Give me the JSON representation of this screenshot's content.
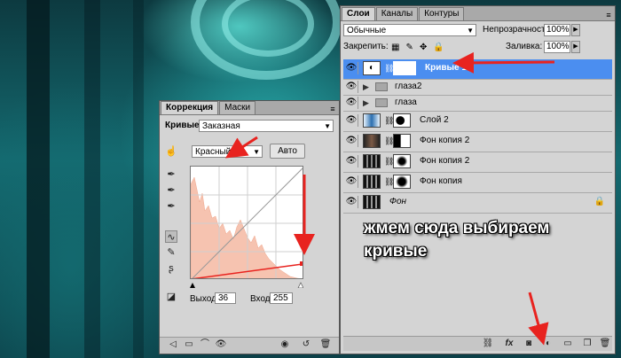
{
  "layers_panel": {
    "tabs": [
      "Слои",
      "Каналы",
      "Контуры"
    ],
    "blend_mode": "Обычные",
    "opacity_label": "Непрозрачность:",
    "opacity_value": "100%",
    "lock_label": "Закрепить:",
    "fill_label": "Заливка:",
    "fill_value": "100%",
    "layers": [
      {
        "name": "Кривые 1",
        "selected": true
      },
      {
        "name": "глаза2",
        "type": "group"
      },
      {
        "name": "глаза",
        "type": "group"
      },
      {
        "name": "Слой 2"
      },
      {
        "name": "Фон копия 2"
      },
      {
        "name": "Фон копия 2"
      },
      {
        "name": "Фон копия"
      },
      {
        "name": "Фон",
        "locked": true
      }
    ],
    "footer_icons": [
      "link-icon",
      "fx-icon",
      "mask-icon",
      "adjustment-layer-icon",
      "group-icon",
      "new-layer-icon",
      "trash-icon"
    ]
  },
  "annotation": {
    "line1": "жмем сюда выбираем",
    "line2": "кривые"
  },
  "correction_panel": {
    "tabs": [
      "Коррекция",
      "Маски"
    ],
    "title": "Кривые",
    "preset": "Заказная",
    "channel": "Красный",
    "auto_button": "Авто",
    "output_label": "Выход:",
    "output_value": "36",
    "input_label": "Вход:",
    "input_value": "255"
  },
  "colors": {
    "selection": "#4b8ef0",
    "panel_bg": "#d4d4d4",
    "arrow": "#e8231f",
    "histogram": "#f6c3b0"
  }
}
